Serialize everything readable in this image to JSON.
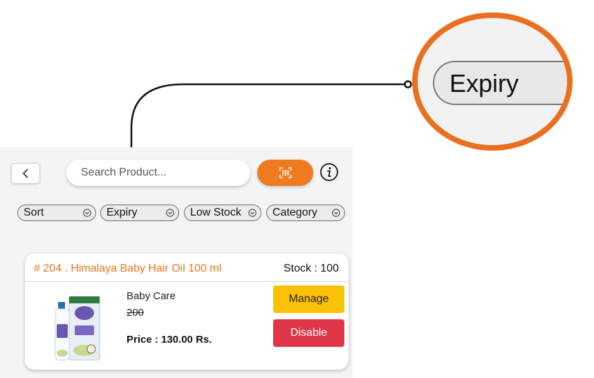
{
  "toolbar": {
    "back_icon": "chevron-left-icon",
    "search_placeholder": "Search Product...",
    "scan_icon": "barcode-scan-icon",
    "info_icon": "info-icon"
  },
  "filters": [
    {
      "label": "Sort"
    },
    {
      "label": "Expiry"
    },
    {
      "label": "Low Stock"
    },
    {
      "label": "Category"
    }
  ],
  "product": {
    "title": "# 204 . Himalaya Baby Hair Oil 100 ml",
    "stock": "Stock : 100",
    "category": "Baby Care",
    "old_price": "200",
    "price": "Price : 130.00 Rs.",
    "manage_label": "Manage",
    "disable_label": "Disable"
  },
  "callout": {
    "zoom_label": "Expiry"
  },
  "colors": {
    "accent": "#f07a1f",
    "manage": "#fbc107",
    "disable": "#df3747",
    "title": "#e8761d"
  }
}
